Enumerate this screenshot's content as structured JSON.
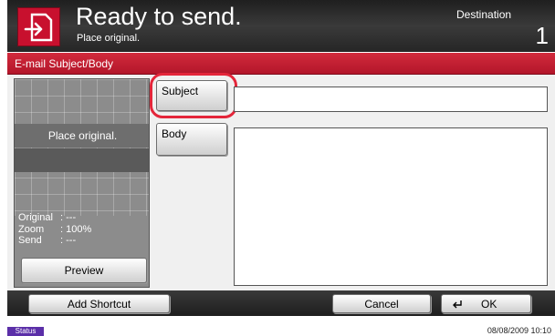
{
  "header": {
    "title": "Ready to send.",
    "subtitle": "Place original.",
    "destination_label": "Destination",
    "destination_count": "1",
    "icon": "send-document-icon"
  },
  "band": {
    "title": "E-mail Subject/Body"
  },
  "preview_panel": {
    "place_text": "Place original.",
    "info": [
      {
        "key": "Original",
        "value": ": ---"
      },
      {
        "key": "Zoom",
        "value": ": 100%"
      },
      {
        "key": "Send",
        "value": ": ---"
      }
    ],
    "preview_button": "Preview"
  },
  "form": {
    "subject_button": "Subject",
    "subject_value": "",
    "body_button": "Body",
    "body_value": ""
  },
  "bottom": {
    "add_shortcut": "Add Shortcut",
    "cancel": "Cancel",
    "ok": "OK"
  },
  "status": {
    "label": "Status",
    "datetime": "08/08/2009   10:10"
  },
  "colors": {
    "accent_red": "#c8102e",
    "status_purple": "#5b2fa8"
  }
}
